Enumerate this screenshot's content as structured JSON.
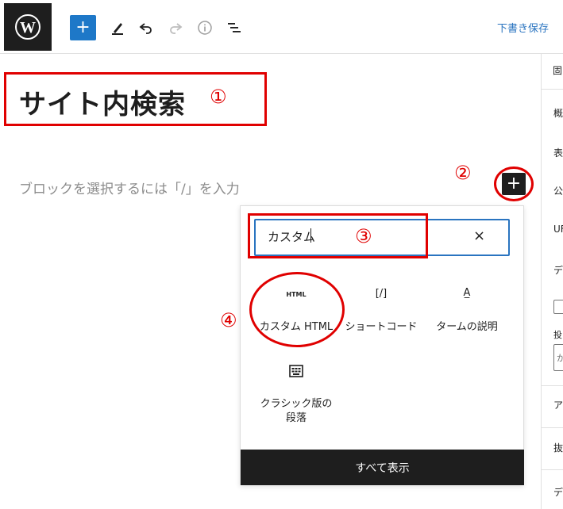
{
  "toolbar": {
    "add_block_symbol": "+",
    "save_draft_label": "下書き保存"
  },
  "editor": {
    "title": "サイト内検索",
    "block_placeholder": "ブロックを選択するには「/」を入力",
    "inserter_symbol": "+"
  },
  "annotations": {
    "n1": "①",
    "n2": "②",
    "n3": "③",
    "n4": "④"
  },
  "inserter_popup": {
    "search_value": "カスタム",
    "clear_symbol": "×",
    "blocks": [
      {
        "icon_text": "HTML",
        "label": "カスタム HTML"
      },
      {
        "icon_text": "[/]",
        "label": "ショートコード"
      },
      {
        "icon_text": "A̲",
        "label": "タームの説明"
      },
      {
        "icon_text": "",
        "label_line1": "クラシック版の",
        "label_line2": "段落"
      }
    ],
    "browse_all_label": "すべて表示"
  },
  "sidebar": {
    "tab": "固",
    "items": [
      "概",
      "表",
      "公",
      "UF",
      "デ",
      "投",
      "ア",
      "抜",
      "デ"
    ],
    "field_value": "か"
  },
  "colors": {
    "accent": "#1e78c8",
    "dark": "#1e1e1e",
    "annotation_red": "#e00000",
    "link_blue": "#2a74c0"
  }
}
